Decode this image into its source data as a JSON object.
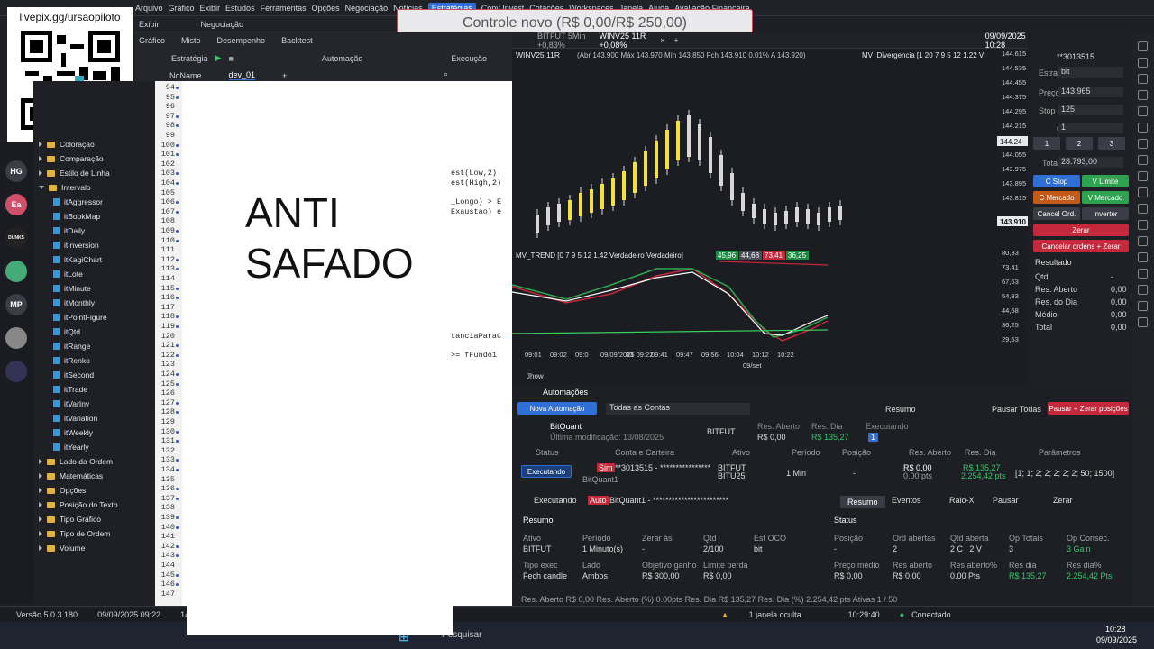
{
  "topbar": {
    "items": [
      "Arquivo",
      "Gráfico",
      "Exibir",
      "Estudos",
      "Ferramentas",
      "Opções",
      "Negociação",
      "Notícias",
      "Estratégias",
      "Copy Invest",
      "Cotações",
      "Workspaces",
      "Janela",
      "Ajuda",
      "Avaliação Financeira"
    ],
    "active": "Estratégias"
  },
  "toolbar2": {
    "exibir": "Exibir",
    "negociacao": "Negociação"
  },
  "toast": {
    "text": "Controle novo (R$ 0,00/R$ 250,00)"
  },
  "qr": {
    "label": "livepix.gg/ursaopiloto"
  },
  "avatars": [
    {
      "text": "HG",
      "color": "#3a3d45"
    },
    {
      "text": "Ea",
      "color": "#d0506a"
    },
    {
      "text": "DUNKS",
      "color": "#222"
    },
    {
      "text": "",
      "color": "#4a7"
    },
    {
      "text": "MP",
      "color": "#3a3d45"
    },
    {
      "text": "",
      "color": "#888"
    },
    {
      "text": "",
      "color": "#335"
    }
  ],
  "editor_tabs": {
    "tabs": [
      "Gráfico",
      "Misto",
      "Desempenho",
      "Backtest"
    ],
    "estrategia": "Estratégia",
    "automacao": "Automação",
    "execucao": "Execução",
    "noname": "NoName",
    "dev": "dev_01"
  },
  "tree": {
    "top": [
      "Coloração",
      "Comparação",
      "Estilo de Linha"
    ],
    "intervalo": "Intervalo",
    "intervalo_items": [
      "itAggressor",
      "itBookMap",
      "itDaily",
      "itInversion",
      "itKagiChart",
      "itLote",
      "itMinute",
      "itMonthly",
      "itPointFigure",
      "itQtd",
      "itRange",
      "itRenko",
      "itSecond",
      "itTrade",
      "itVarInv",
      "itVariation",
      "itWeekly",
      "itYearly"
    ],
    "bottom": [
      "Lado da Ordem",
      "Matemáticas",
      "Opções",
      "Posição do Texto",
      "Tipo Gráfico",
      "Tipo de Ordem",
      "Volume"
    ]
  },
  "editor": {
    "line_start": 94,
    "line_end": 147,
    "overlay_line1": "ANTI",
    "overlay_line2": "SAFADO",
    "code": [
      {
        "line": 103,
        "text": "est(Low,2)"
      },
      {
        "line": 104,
        "text": "est(High,2)"
      },
      {
        "line": 106,
        "text": "_Longo) > E"
      },
      {
        "line": 107,
        "text": "Exaustao) e"
      },
      {
        "line": 120,
        "text": "tanciaParaC"
      },
      {
        "line": 122,
        "text": ">= fFundo1"
      }
    ]
  },
  "chart": {
    "tabs": [
      "BITFUT 5Min +0,83%",
      "WINV25 11R +0,08%"
    ],
    "date": "09/09/2025 10:28",
    "header": "WINV25 11R",
    "ohlc": "(Abr 143.900 Máx 143.970 Mín 143.850 Fch 143.910 0.01% A 143.920)",
    "study": "MV_Divergencia [1 20 7 9 5 12 1.22 V",
    "price_axis": [
      "144.615",
      "144.535",
      "144.455",
      "144.375",
      "144.295",
      "144.215",
      "144.135",
      "144.055",
      "143.975",
      "143.895",
      "143.815"
    ],
    "current_price": "143.910",
    "last_price_tag": "144.24",
    "osc_header": "MV_TREND [0 7 9 5 12 1.42 Verdadeiro Verdadeiro]",
    "osc_vals": [
      {
        "v": "45,96",
        "c": "#1f8a43"
      },
      {
        "v": "44,68",
        "c": "#4a4d55"
      },
      {
        "v": "73,41",
        "c": "#c4283a"
      },
      {
        "v": "36,25",
        "c": "#1f8a43"
      }
    ],
    "osc_axis": [
      "80,33",
      "73,41",
      "67,63",
      "54,93",
      "44,68",
      "36,25",
      "29,53"
    ],
    "time_axis": [
      "09:01",
      "09:02",
      "09:0",
      "09/09/2025 09:22",
      "33",
      "09:41",
      "09:47",
      "09:56",
      "10:04",
      "10:12",
      "10:22"
    ],
    "date_label": "09/set",
    "tab_bottom": "Jhow"
  },
  "side": {
    "estrat_label": "Estrat.",
    "estrat": "bit",
    "sim": "Sim",
    "account": "**3013515",
    "preco_label": "Preço",
    "preco": "143.965",
    "stop_label": "Stop Of.",
    "stop": "125",
    "qtd_label": "Qtd",
    "qtd": "1",
    "qbtns": [
      "1",
      "2",
      "3"
    ],
    "total_label": "Total",
    "total": "28.793,00",
    "cur": "R$",
    "btns": {
      "cstop": "C Stop",
      "vlimite": "V Limite",
      "cmercado": "C Mercado",
      "vmercado": "V Mercado",
      "cancel": "Cancel Ord.",
      "inverter": "Inverter",
      "zerar": "Zerar",
      "cancel_zerar": "Cancelar ordens + Zerar"
    },
    "resultado": "Resultado",
    "rows": [
      {
        "k": "Qtd",
        "v": "-"
      },
      {
        "k": "Res. Aberto",
        "v": "0,00"
      },
      {
        "k": "Res. do Dia",
        "v": "0,00"
      },
      {
        "k": "Médio",
        "v": "0,00"
      },
      {
        "k": "Total",
        "v": "0,00"
      }
    ]
  },
  "auto": {
    "title": "Automações",
    "nova": "Nova Automação",
    "contas": "Todas as Contas",
    "resumo_btn": "Resumo",
    "pausar_todas": "Pausar Todas",
    "pausar_zerar": "Pausar + Zerar posições",
    "bot": {
      "name": "BitQuant",
      "mod": "Última modificação: 13/08/2025",
      "asset": "BITFUT",
      "res_aberto_l": "Res. Aberto",
      "res_aberto": "R$ 0,00",
      "res_dia_l": "Res. Dia",
      "res_dia": "R$ 135,27",
      "exec_l": "Executando",
      "exec": "1"
    },
    "cols": [
      "Status",
      "Conta e Carteira",
      "Ativo",
      "Período",
      "Posição",
      "Res. Aberto",
      "Res. Dia",
      "Parâmetros"
    ],
    "row": {
      "status": "Executando",
      "sim": "Sim",
      "conta": "**3013515 - ****************",
      "carteira": "BitQuant1",
      "ativo1": "BITFUT",
      "ativo2": "BITU25",
      "periodo": "1 Min",
      "posicao": "-",
      "res_aberto": "R$ 0,00",
      "pts": "0.00 pts",
      "res_dia": "R$ 135,27",
      "res_dia2": "2.254,42 pts",
      "params": "[1; 1; 2; 2; 2; 2; 2; 50; 1500]"
    },
    "detail": {
      "exec": "Executando",
      "auto": "Auto",
      "name": "BitQuant1 - ************************",
      "tabs": [
        "Resumo",
        "Eventos",
        "Raio-X",
        "Pausar",
        "Zerar"
      ]
    },
    "resumo": {
      "title": "Resumo",
      "h": [
        "Ativo",
        "Período",
        "Zerar às",
        "Qtd",
        "Est OCO"
      ],
      "v": [
        "BITFUT",
        "1 Minuto(s)",
        "-",
        "2/100",
        "bit"
      ],
      "h2": [
        "Tipo exec",
        "Lado",
        "Objetivo ganho",
        "Limite perda"
      ],
      "v2": [
        "Fech candle",
        "Ambos",
        "R$ 300,00",
        "R$ 0,00"
      ]
    },
    "status": {
      "title": "Status",
      "h": [
        "Posição",
        "Ord abertas",
        "Qtd aberta",
        "Op Totais",
        "Op Consec."
      ],
      "v": [
        "-",
        "2",
        "2 C | 2 V",
        "3",
        "3 Gain"
      ],
      "h2": [
        "Preço médio",
        "Res aberto",
        "Res aberto%",
        "Res dia",
        "Res dia%"
      ],
      "v2": [
        "R$ 0,00",
        "R$ 0,00",
        "0.00 Pts",
        "R$ 135,27",
        "2.254,42 Pts"
      ]
    },
    "footer": "Res. Aberto  R$ 0,00   Res. Aberto (%)  0.00pts   Res. Dia  R$ 135,27   Res. Dia (%)  2.254,42 pts   Ativas  1 / 50"
  },
  "status": {
    "version": "Versão 5.0.3.180",
    "date": "09/09/2025 09:22",
    "val": "144.24",
    "hidden": "1 janela oculta",
    "time": "10:29:40",
    "conn": "Conectado"
  },
  "taskbar": {
    "search": "Pesquisar",
    "clock": "10:28",
    "date": "09/09/2025"
  },
  "candles": [
    [
      2,
      140,
      120,
      0
    ],
    [
      3,
      132,
      112,
      0
    ],
    [
      4,
      128,
      108,
      0
    ],
    [
      5,
      126,
      104,
      1
    ],
    [
      6,
      122,
      96,
      1
    ],
    [
      7,
      118,
      92,
      1
    ],
    [
      8,
      114,
      86,
      1
    ],
    [
      9,
      110,
      80,
      1
    ],
    [
      10,
      104,
      72,
      1
    ],
    [
      11,
      96,
      62,
      1
    ],
    [
      12,
      88,
      50,
      1
    ],
    [
      13,
      80,
      38,
      1
    ],
    [
      14,
      70,
      26,
      1
    ],
    [
      15,
      60,
      16,
      1
    ],
    [
      16,
      56,
      10,
      0
    ],
    [
      17,
      60,
      20,
      0
    ],
    [
      18,
      74,
      34,
      0
    ],
    [
      19,
      88,
      54,
      0
    ],
    [
      20,
      104,
      74,
      0
    ],
    [
      21,
      116,
      96,
      0
    ],
    [
      22,
      124,
      108,
      0
    ],
    [
      23,
      130,
      114,
      0
    ],
    [
      24,
      132,
      118,
      0
    ],
    [
      25,
      130,
      116,
      0
    ],
    [
      26,
      128,
      112,
      0
    ],
    [
      27,
      130,
      114,
      0
    ],
    [
      28,
      132,
      118,
      0
    ],
    [
      29,
      128,
      112,
      0
    ],
    [
      30,
      126,
      110,
      0
    ]
  ]
}
